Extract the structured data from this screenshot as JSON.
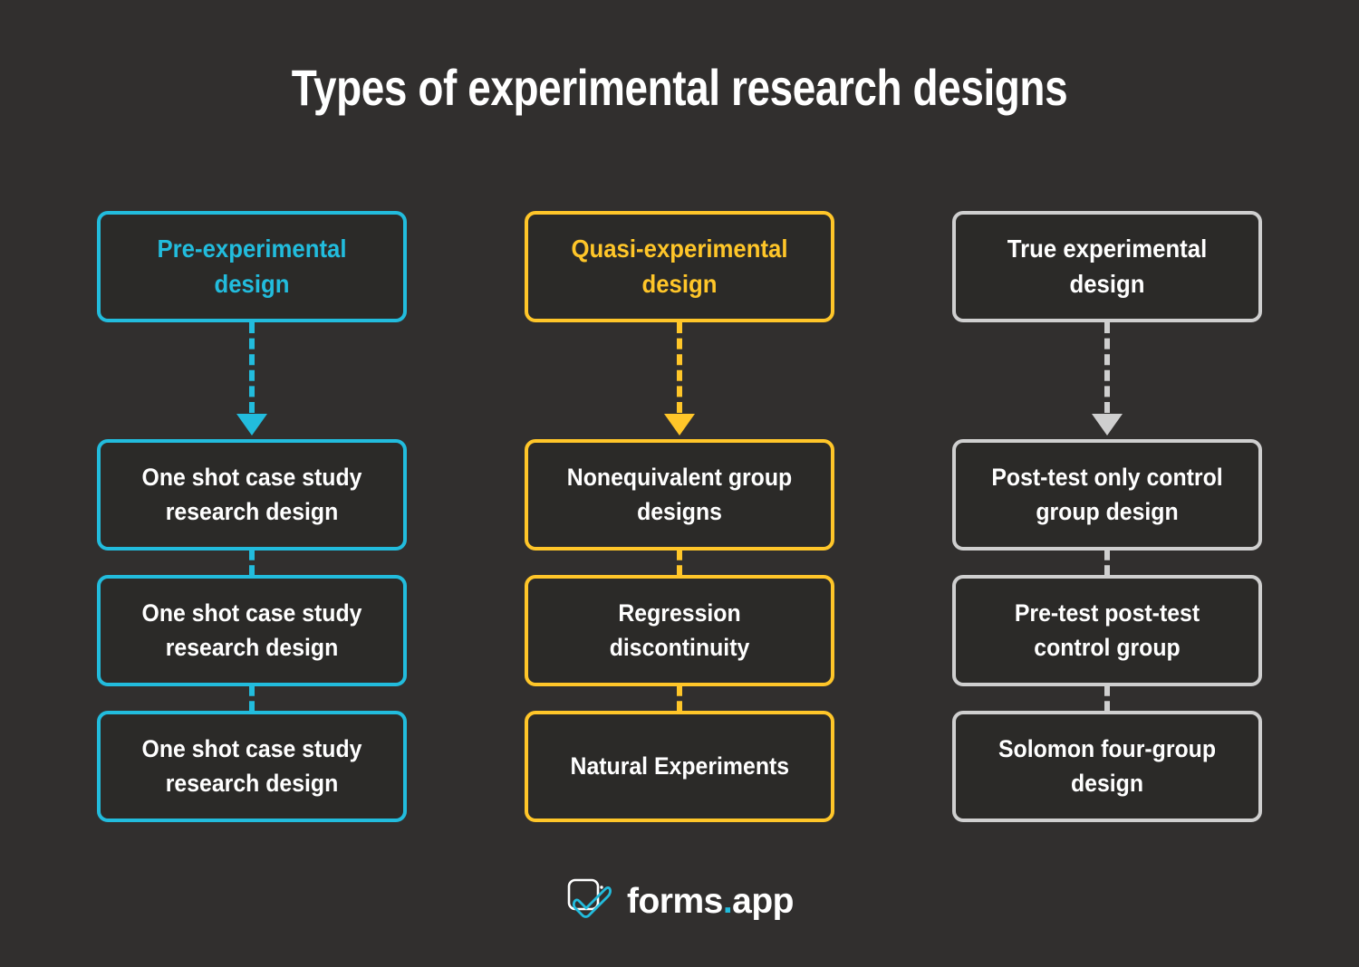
{
  "page": {
    "title": "Types of experimental research designs",
    "background_color": "#312f2e",
    "box_fill_color": "#2b2a28"
  },
  "columns": [
    {
      "id": "pre-experimental",
      "accent_color": "#22bcdd",
      "head": {
        "label": "Pre-experimental design"
      },
      "items": [
        {
          "label": "One shot case study research design"
        },
        {
          "label": "One shot case study research design"
        },
        {
          "label": "One shot case study research design"
        }
      ]
    },
    {
      "id": "quasi-experimental",
      "accent_color": "#ffc629",
      "head": {
        "label": "Quasi-experimental design"
      },
      "items": [
        {
          "label": "Nonequivalent group designs"
        },
        {
          "label": "Regression discontinuity"
        },
        {
          "label": "Natural Experiments"
        }
      ]
    },
    {
      "id": "true-experimental",
      "accent_color": "#cfcfcf",
      "head": {
        "label": "True experimental design"
      },
      "items": [
        {
          "label": "Post-test only control group design"
        },
        {
          "label": "Pre-test post-test control group"
        },
        {
          "label": "Solomon four-group design"
        }
      ]
    }
  ],
  "footer": {
    "logo_icon": "forms-app-check-logo-icon",
    "logo_name": "forms",
    "logo_dot": ".",
    "logo_suffix": "app",
    "logo_accent_color": "#22bcdd"
  }
}
